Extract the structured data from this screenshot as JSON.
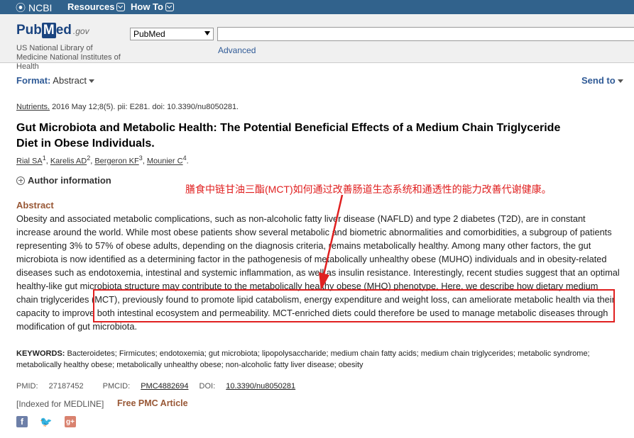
{
  "ncbi": {
    "logo": "NCBI",
    "menu": [
      "Resources",
      "How To"
    ]
  },
  "pubmed": {
    "brand_pub": "Pub",
    "brand_m": "M",
    "brand_ed": "ed",
    "brand_gov": ".gov",
    "subtitle": "US National Library of Medicine National Institutes of Health",
    "db_select": "PubMed",
    "search_value": "",
    "advanced": "Advanced"
  },
  "format": {
    "label": "Format:",
    "value": "Abstract"
  },
  "send_to": "Send to",
  "article": {
    "journal": "Nutrients.",
    "citation_rest": "2016 May 12;8(5). pii: E281. doi: 10.3390/nu8050281.",
    "title": "Gut Microbiota and Metabolic Health: The Potential Beneficial Effects of a Medium Chain Triglyceride Diet in Obese Individuals.",
    "authors": [
      {
        "name": "Rial SA",
        "sup": "1",
        "sep": ", "
      },
      {
        "name": "Karelis AD",
        "sup": "2",
        "sep": ", "
      },
      {
        "name": "Bergeron KF",
        "sup": "3",
        "sep": ", "
      },
      {
        "name": "Mounier C",
        "sup": "4",
        "sep": "."
      }
    ],
    "author_info": "Author information",
    "abstract_heading": "Abstract",
    "abstract_part1": "Obesity and associated metabolic complications, such as non-alcoholic fatty liver disease (NAFLD) and type 2 diabetes (T2D), are in constant increase around the world. While most obese patients show several metabolic and biometric abnormalities and comorbidities, a subgroup of patients representing 3% to 57% of obese adults, depending on the diagnosis criteria, remains metabolically healthy. Among many other factors, the gut microbiota is now identified as a determining factor in the pathogenesis of metabolically unhealthy obese (MUHO) individuals and in obesity-related diseases such as endotoxemia, intestinal and systemic inflammation, as well as insulin resistance. Interestingly, recent studies suggest that an optimal healthy-like gut microbiota structure may contribute to the metabolically healthy obese (MHO) phenotype. ",
    "abstract_part2": "Here, we describe how dietary medium chain triglycerides (MCT), previously found to promote lipid catabolism, energy expenditure and weight loss, can ameliorate metabolic health via their capacity to improve both intestinal ecosystem and permeability. MCT-enriched diets could therefore be used to manage metabolic diseases through modification of gut microbiota.",
    "keywords_label": "KEYWORDS:",
    "keywords": " Bacteroidetes; Firmicutes; endotoxemia; gut microbiota; lipopolysaccharide; medium chain fatty acids; medium chain triglycerides; metabolic syndrome; metabolically healthy obese; metabolically unhealthy obese; non-alcoholic fatty liver disease; obesity",
    "pmid_label": "PMID:",
    "pmid": "27187452",
    "pmcid_label": "PMCID:",
    "pmcid": "PMC4882694",
    "doi_label": "DOI:",
    "doi": "10.3390/nu8050281",
    "indexed": "[Indexed for MEDLINE]",
    "free_pmc": "Free PMC Article"
  },
  "annotation": "膳食中链甘油三酯(MCT)如何通过改善肠道生态系统和通透性的能力改善代谢健康。",
  "colors": {
    "topbar": "#31628c",
    "annotation": "#e02020",
    "accent": "#985735",
    "link": "#2f5a96"
  },
  "social": {
    "facebook": "f",
    "twitter": "🐦",
    "googleplus": "g+"
  }
}
